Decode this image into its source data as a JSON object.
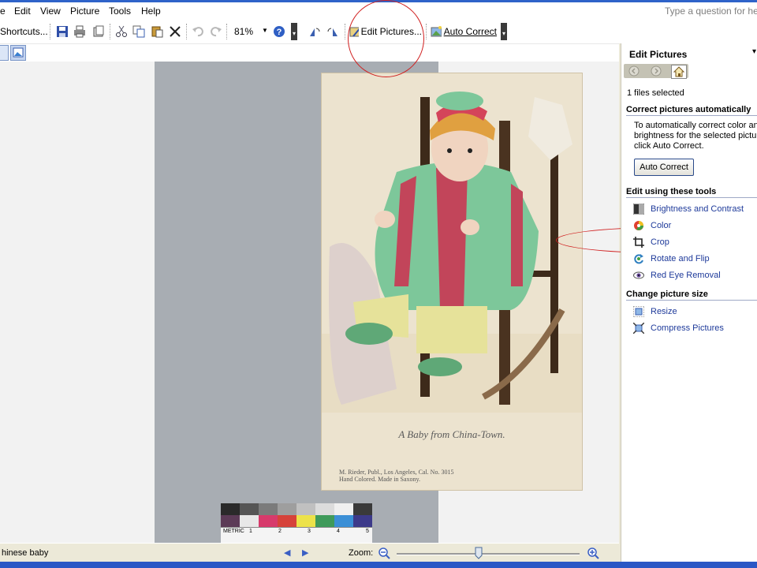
{
  "menu": {
    "file": "e",
    "edit": "Edit",
    "view": "View",
    "picture": "Picture",
    "tools": "Tools",
    "help": "Help",
    "help_box_placeholder": "Type a question for help"
  },
  "toolbar": {
    "shortcuts_label": "Shortcuts...",
    "zoom_value": "81%",
    "edit_pictures_label": "Edit Pictures...",
    "auto_correct_label": "Auto Correct"
  },
  "postcard": {
    "caption": "A Baby from China-Town.",
    "publisher_line1": "M. Rieder, Publ., Los Angeles, Cal.   No. 3015",
    "publisher_line2": "Hand Colored.  Made in Saxony.",
    "ruler_label": "METRIC",
    "ruler_ticks": [
      "1",
      "2",
      "3",
      "4",
      "5"
    ],
    "color_patches": [
      "#2a2a2a",
      "#555",
      "#7b7b7b",
      "#9e9e9e",
      "#c0c0c0",
      "#dcdcdc",
      "#f0f0f0",
      "#3a3a3a",
      "#5c3b57",
      "#e8e8e8",
      "#d73a6b",
      "#d6423a",
      "#ece24a",
      "#3f9a5a",
      "#3b8fd6",
      "#3d3a8a"
    ]
  },
  "status": {
    "file_name": "hinese baby",
    "zoom_label": "Zoom:",
    "zoom_level": 0.45
  },
  "pane": {
    "title": "Edit Pictures",
    "files_selected": "1 files selected",
    "section_auto": "Correct pictures automatically",
    "auto_desc_1": "To automatically correct color and",
    "auto_desc_2": "brightness for the selected picture,",
    "auto_desc_3": "click Auto Correct.",
    "auto_button": "Auto Correct",
    "section_tools": "Edit using these tools",
    "tools": [
      {
        "label": "Brightness and Contrast",
        "icon": "brightness-icon"
      },
      {
        "label": "Color",
        "icon": "color-icon"
      },
      {
        "label": "Crop",
        "icon": "crop-icon"
      },
      {
        "label": "Rotate and Flip",
        "icon": "rotate-icon"
      },
      {
        "label": "Red Eye Removal",
        "icon": "eye-icon"
      }
    ],
    "section_size": "Change picture size",
    "size_tools": [
      {
        "label": "Resize",
        "icon": "resize-icon"
      },
      {
        "label": "Compress Pictures",
        "icon": "compress-icon"
      }
    ]
  }
}
